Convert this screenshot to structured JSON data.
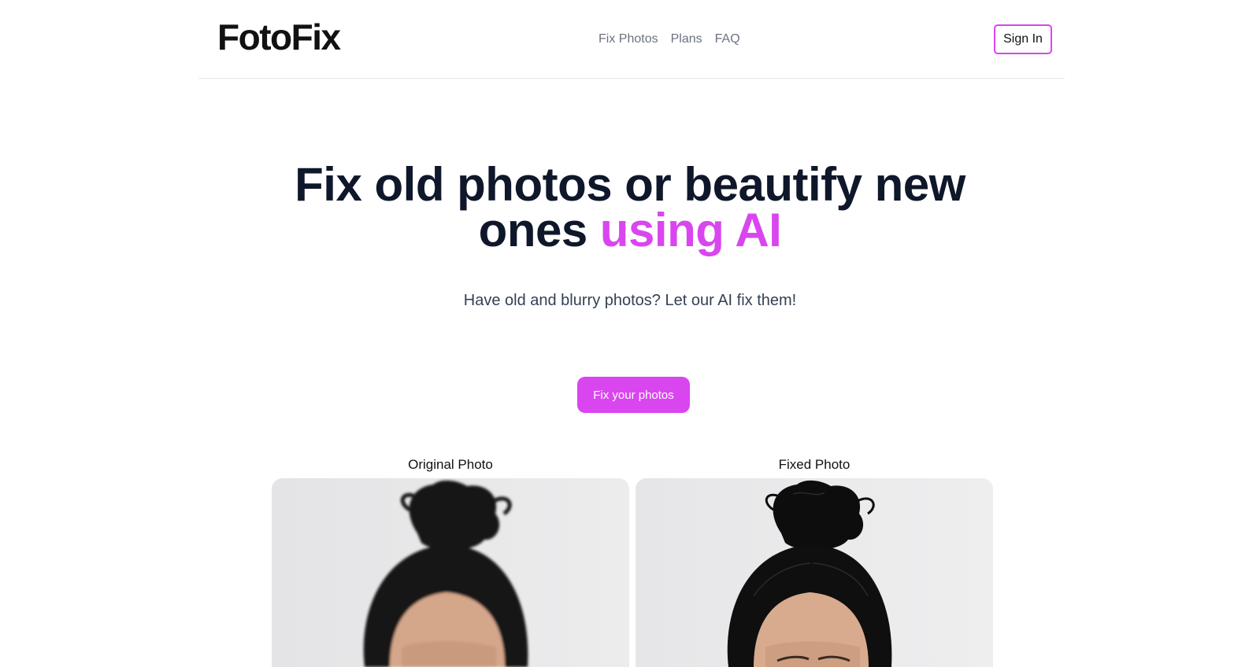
{
  "header": {
    "logo": "FotoFix",
    "nav": [
      {
        "label": "Fix Photos"
      },
      {
        "label": "Plans"
      },
      {
        "label": "FAQ"
      }
    ],
    "sign_in_label": "Sign In"
  },
  "hero": {
    "title_main": "Fix old photos or beautify new ones",
    "title_accent": "using AI",
    "subtitle": "Have old and blurry photos? Let our AI fix them!",
    "cta_label": "Fix your photos"
  },
  "comparison": {
    "original_label": "Original Photo",
    "fixed_label": "Fixed Photo"
  },
  "colors": {
    "accent": "#d946ef",
    "heading": "#0f172a",
    "muted": "#6b7280"
  }
}
